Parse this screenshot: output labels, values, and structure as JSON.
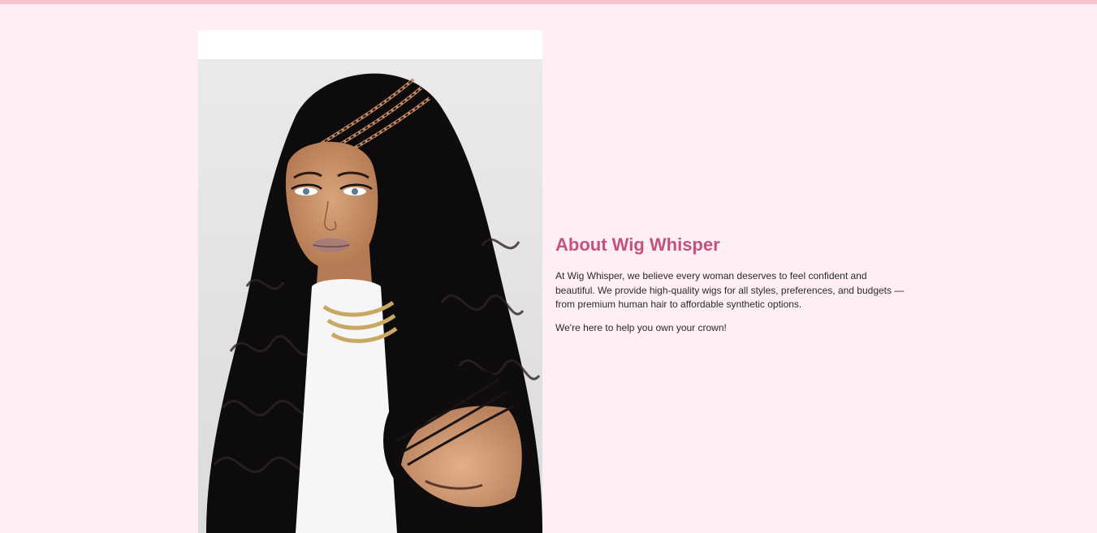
{
  "about": {
    "title": "About Wig Whisper",
    "paragraph_1": "At Wig Whisper, we believe every woman deserves to feel confident and beautiful. We provide high-quality wigs for all styles, preferences, and budgets — from premium human hair to affordable synthetic options.",
    "paragraph_2": "We're here to help you own your crown!",
    "image": {
      "subject": "model-wearing-long-wavy-black-wig-with-braids"
    }
  },
  "colors": {
    "page_background": "#ffeef3",
    "top_bar": "#f9c3cf",
    "title": "#c2527e",
    "body_text": "#2b2b2b",
    "card_background": "#ffffff"
  }
}
